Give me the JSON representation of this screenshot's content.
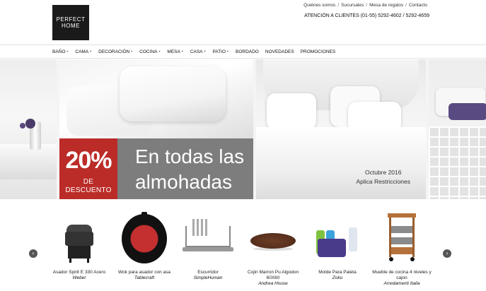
{
  "header": {
    "logo_line1": "PERFECT",
    "logo_line2": "HOME",
    "top_links": [
      "Quiénes somos",
      "Sucursales",
      "Mesa de regalos",
      "Contacto"
    ],
    "contact": "ATENCIÓN A CLIENTES (01-55) 5292-4602 / 5292-4659"
  },
  "nav": {
    "items": [
      {
        "label": "BAÑO",
        "has_dropdown": true
      },
      {
        "label": "CAMA",
        "has_dropdown": true
      },
      {
        "label": "DECORACIÓN",
        "has_dropdown": true
      },
      {
        "label": "COCINA",
        "has_dropdown": true
      },
      {
        "label": "MESA",
        "has_dropdown": true
      },
      {
        "label": "CASA",
        "has_dropdown": true
      },
      {
        "label": "PATIO",
        "has_dropdown": true
      },
      {
        "label": "BORDADO",
        "has_dropdown": false
      },
      {
        "label": "NOVEDADES",
        "has_dropdown": false
      },
      {
        "label": "PROMOCIONES",
        "has_dropdown": false
      }
    ],
    "caret": "▼"
  },
  "hero": {
    "percent": "20%",
    "discount": "DE DESCUENTO",
    "headline_line1": "En todas las",
    "headline_line2": "almohadas",
    "note_line1": "Octubre 2016",
    "note_line2": "Aplica Restricciones",
    "colors": {
      "promo_red": "#bb2c28",
      "promo_gray": "#7d7d7d"
    }
  },
  "carousel": {
    "prev_icon": "‹",
    "next_icon": "›",
    "products": [
      {
        "name": "Asador Spirit E 330 Acero",
        "brand": "Weber"
      },
      {
        "name": "Wok para asador con asa",
        "brand": "Tablecraft"
      },
      {
        "name": "Escurridor",
        "brand": "SimpleHuman"
      },
      {
        "name": "Cojin Marron Pu Algodon 60X60",
        "brand": "Andrea House"
      },
      {
        "name": "Molde Para Paleta",
        "brand": "Zoku"
      },
      {
        "name": "Mueble de cocina 4 niveles y cajon",
        "brand": "Arredamenti Italia"
      }
    ]
  }
}
